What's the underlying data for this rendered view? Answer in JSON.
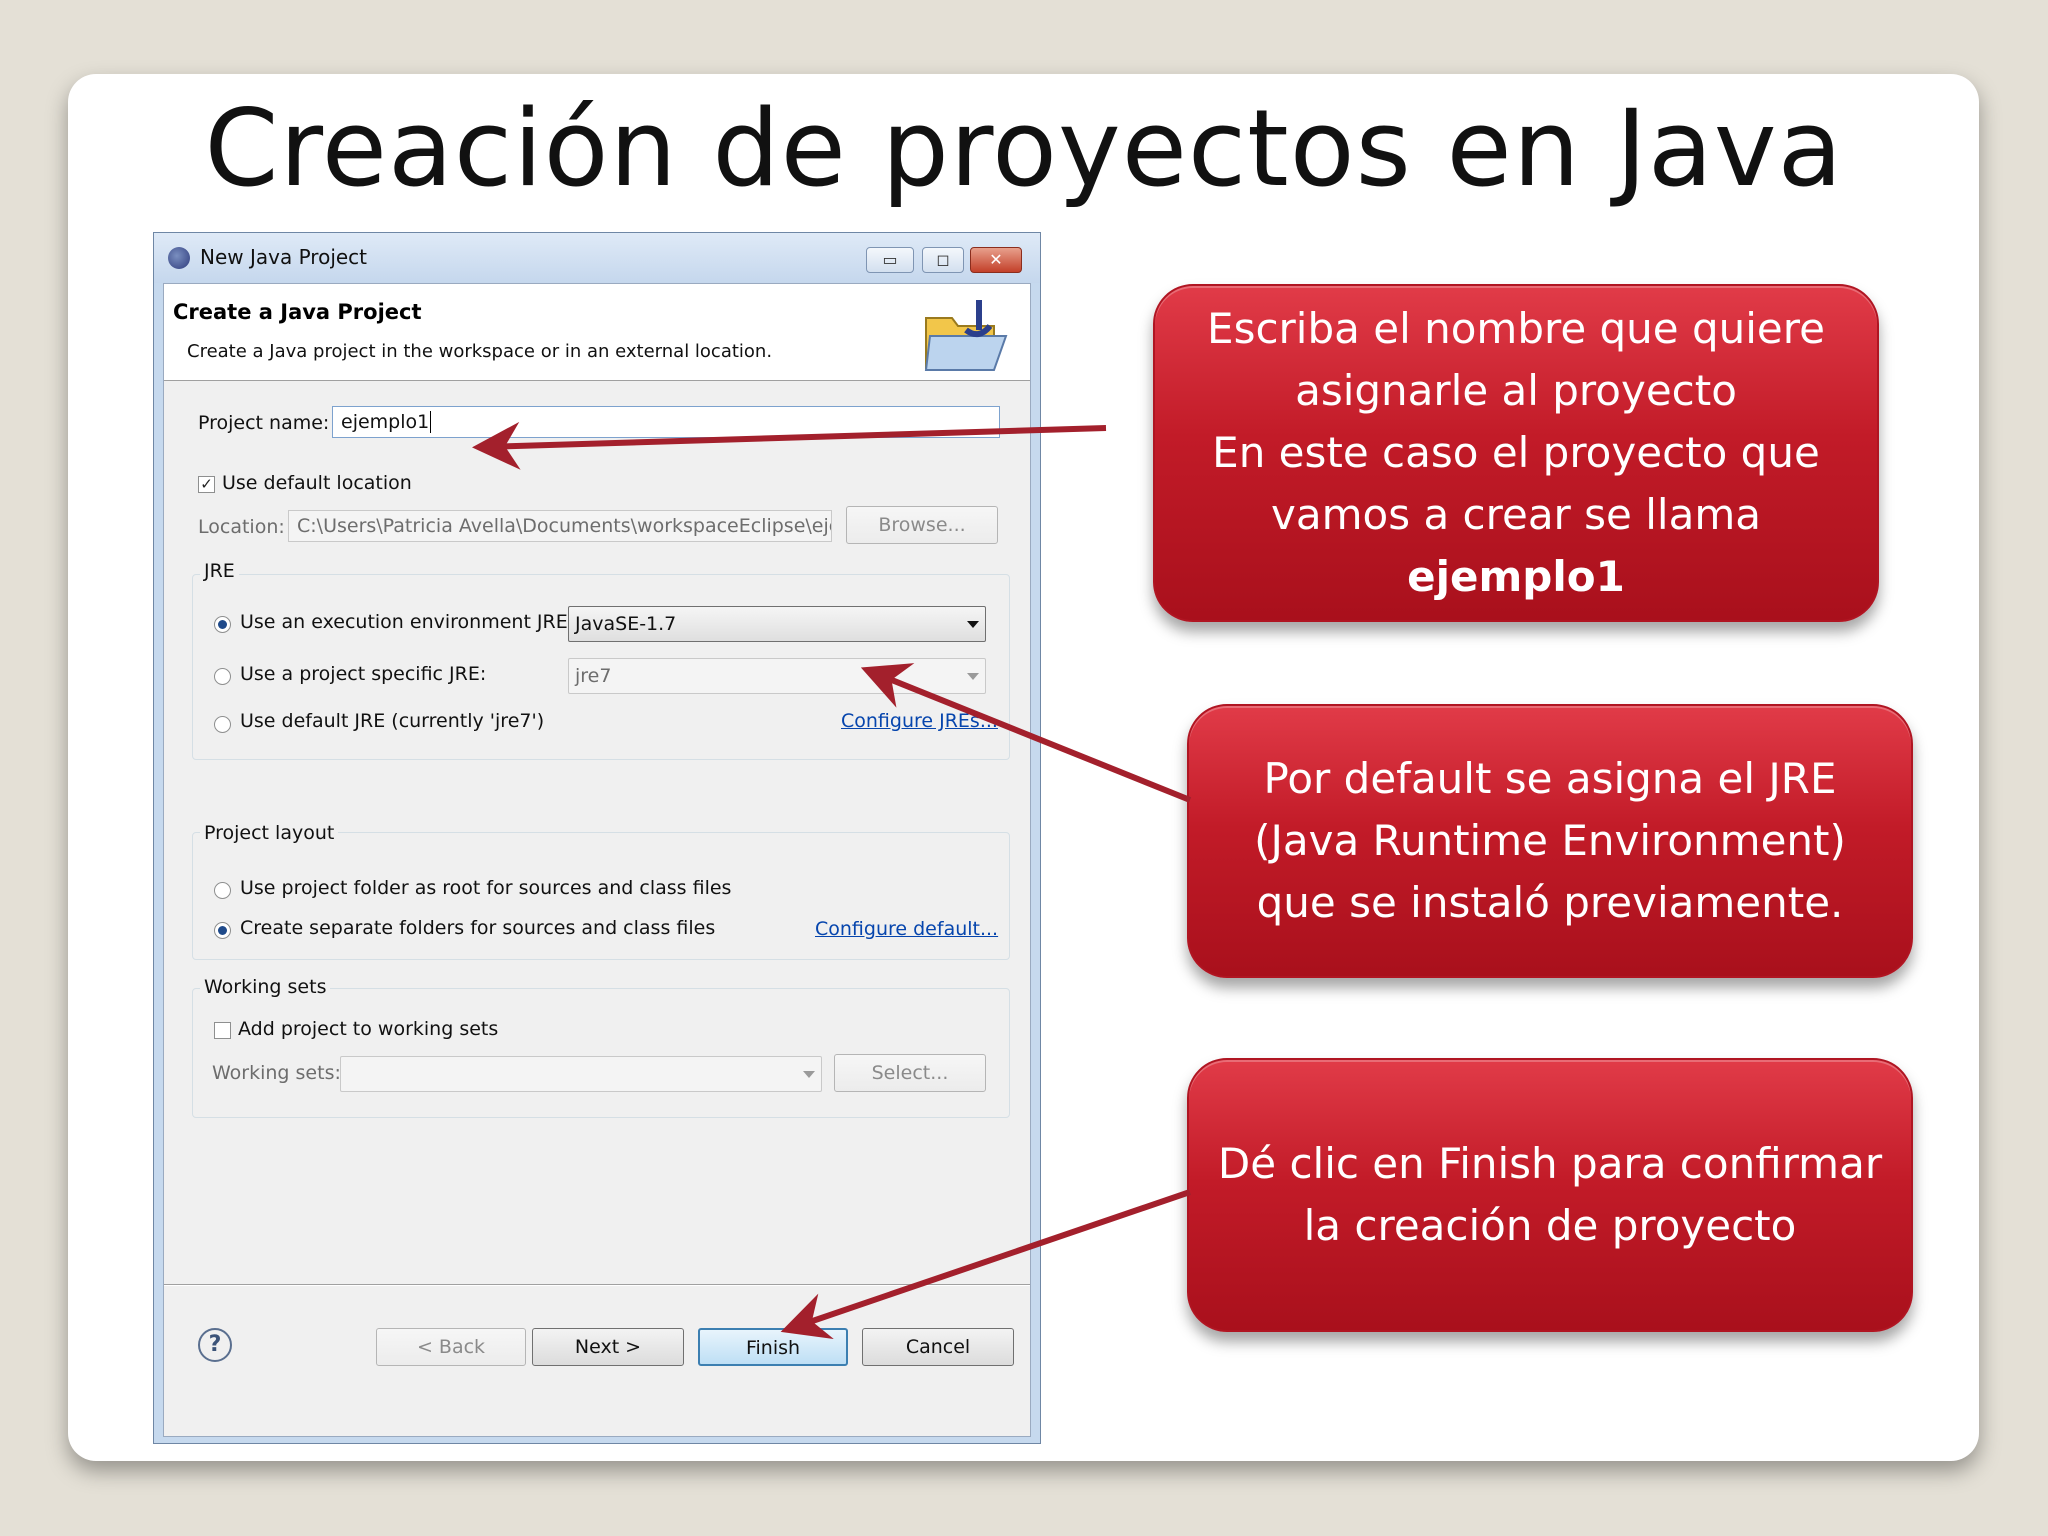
{
  "slide": {
    "title": "Creación de proyectos en Java"
  },
  "window": {
    "title": "New Java Project",
    "header_title": "Create a Java Project",
    "header_desc": "Create a Java project in the workspace or in an external location.",
    "minimize": "▭",
    "maximize": "◻",
    "close": "✕"
  },
  "form": {
    "project_name_label": "Project name:",
    "project_name_value": "ejemplo1",
    "use_default_location_label": "Use default location",
    "use_default_location_checked": true,
    "location_label": "Location:",
    "location_value": "C:\\Users\\Patricia Avella\\Documents\\workspaceEclipse\\ejem",
    "browse_label": "Browse..."
  },
  "jre": {
    "group_label": "JRE",
    "option_exec_env": "Use an execution environment JRE:",
    "exec_env_value": "JavaSE-1.7",
    "option_project_specific": "Use a project specific JRE:",
    "project_specific_value": "jre7",
    "option_default": "Use default JRE (currently 'jre7')",
    "configure_link": "Configure JREs...",
    "selected": "exec_env"
  },
  "layout": {
    "group_label": "Project layout",
    "option_root": "Use project folder as root for sources and class files",
    "option_separate": "Create separate folders for sources and class files",
    "configure_link": "Configure default...",
    "selected": "separate"
  },
  "working_sets": {
    "group_label": "Working sets",
    "add_label": "Add project to working sets",
    "add_checked": false,
    "sets_label": "Working sets:",
    "select_label": "Select..."
  },
  "buttons": {
    "back": "< Back",
    "next": "Next >",
    "finish": "Finish",
    "cancel": "Cancel",
    "help": "?"
  },
  "callouts": [
    {
      "lines": [
        "Escriba el nombre que quiere",
        "asignarle al proyecto",
        "En este caso el proyecto que",
        "vamos a crear se llama"
      ],
      "bold_line": "ejemplo1"
    },
    {
      "lines": [
        "Por default se asigna el JRE",
        "(Java Runtime Environment)",
        "que se instaló previamente."
      ]
    },
    {
      "lines": [
        "Dé clic en Finish para confirmar",
        "la creación de proyecto"
      ]
    }
  ],
  "colors": {
    "callout_red": "#c21b28",
    "arrow": "#a3202c",
    "link": "#0645ad"
  }
}
